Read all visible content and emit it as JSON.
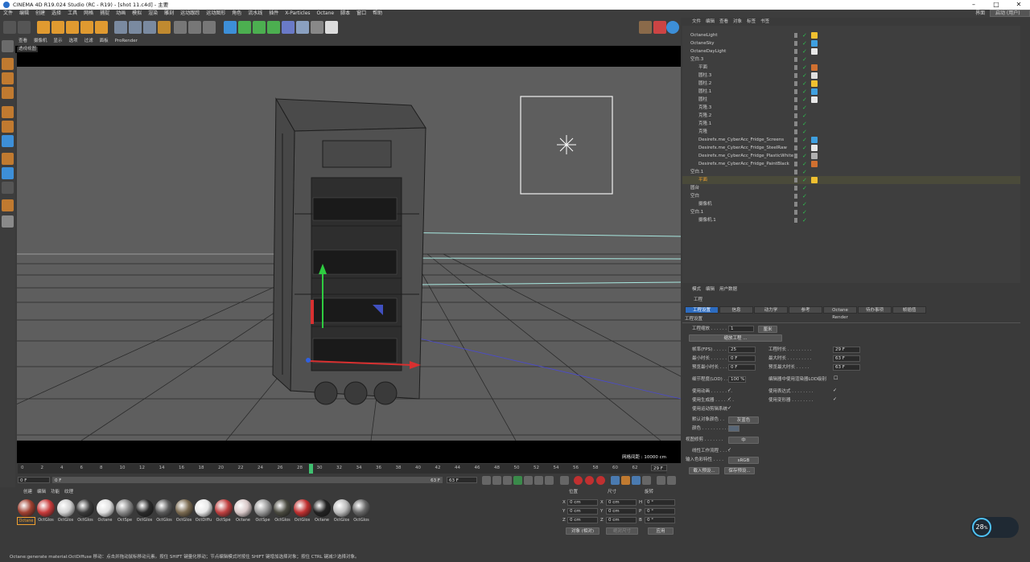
{
  "title": "CINEMA 4D R19.024 Studio (RC - R19) - [shot 11.c4d] - 主要",
  "layout": {
    "label": "界面",
    "value": "启动 (用户)"
  },
  "menu": [
    "文件",
    "编辑",
    "创建",
    "选择",
    "工具",
    "网格",
    "捕捉",
    "动画",
    "模拟",
    "渲染",
    "雕刻",
    "运动跟踪",
    "运动图形",
    "角色",
    "流水线",
    "插件",
    "X-Particles",
    "Octane",
    "脚本",
    "窗口",
    "帮助"
  ],
  "viewport": {
    "menu": [
      "查看",
      "摄像机",
      "显示",
      "选项",
      "过滤",
      "面板",
      "ProRender"
    ],
    "tab": "透视视图",
    "info": "网格间距 : 10000 cm"
  },
  "timeline": {
    "ticks": [
      "0",
      "2",
      "4",
      "6",
      "8",
      "10",
      "12",
      "14",
      "16",
      "18",
      "20",
      "22",
      "24",
      "26",
      "28",
      "30",
      "32",
      "34",
      "36",
      "38",
      "40",
      "42",
      "44",
      "46",
      "48",
      "50",
      "52",
      "54",
      "56",
      "58",
      "60",
      "62"
    ],
    "current": "29 F",
    "start": "0 F",
    "field2": "0 F",
    "end_a": "63 F",
    "end_b": "63 F"
  },
  "materials": {
    "tabs": [
      "创建",
      "编辑",
      "功能",
      "纹理"
    ],
    "items": [
      "Octane",
      "OctGlos",
      "OctGlos",
      "OctGlos",
      "Octane",
      "OctSpe",
      "OctGlos",
      "OctGlos",
      "OctGlos",
      "OctDiffu",
      "OctSpe",
      "Octane",
      "OctSpe",
      "OctGlos",
      "OctGlos",
      "Octane",
      "OctGlos",
      "OctGlos"
    ]
  },
  "coords": {
    "headers": [
      "位置",
      "尺寸",
      "旋转"
    ],
    "rows": [
      {
        "axis": "X",
        "pos": "0 cm",
        "size_axis": "X",
        "size": "0 cm",
        "rot_axis": "H",
        "rot": "0 °"
      },
      {
        "axis": "Y",
        "pos": "0 cm",
        "size_axis": "Y",
        "size": "0 cm",
        "rot_axis": "P",
        "rot": "0 °"
      },
      {
        "axis": "Z",
        "pos": "0 cm",
        "size_axis": "Z",
        "size": "0 cm",
        "rot_axis": "B",
        "rot": "0 °"
      }
    ],
    "mode": "对象 (相对)",
    "size_mode": "绝对尺寸",
    "apply": "应用"
  },
  "objects": {
    "menu": [
      "文件",
      "编辑",
      "查看",
      "对象",
      "标签",
      "书签"
    ],
    "rows": [
      {
        "name": "OctaneLight",
        "indent": 0
      },
      {
        "name": "OctaneSky",
        "indent": 0
      },
      {
        "name": "OctaneDayLight",
        "indent": 0
      },
      {
        "name": "空白.3",
        "indent": 0
      },
      {
        "name": "平面",
        "indent": 1
      },
      {
        "name": "圆柱.3",
        "indent": 1
      },
      {
        "name": "圆柱.2",
        "indent": 1
      },
      {
        "name": "圆柱.1",
        "indent": 1
      },
      {
        "name": "圆柱",
        "indent": 1
      },
      {
        "name": "克隆.3",
        "indent": 1
      },
      {
        "name": "克隆.2",
        "indent": 1
      },
      {
        "name": "克隆.1",
        "indent": 1
      },
      {
        "name": "克隆",
        "indent": 1
      },
      {
        "name": "Desirefx.me_CyberAcc_Fridge_Screens",
        "indent": 1
      },
      {
        "name": "Desirefx.me_CyberAcc_Fridge_SteelRaw",
        "indent": 1
      },
      {
        "name": "Desirefx.me_CyberAcc_Fridge_PlasticWhite",
        "indent": 1
      },
      {
        "name": "Desirefx.me_CyberAcc_Fridge_PaintBlack",
        "indent": 1
      },
      {
        "name": "空白.1",
        "indent": 0
      },
      {
        "name": "平面",
        "indent": 1
      },
      {
        "name": "圆台",
        "indent": 0
      },
      {
        "name": "空白",
        "indent": 0
      },
      {
        "name": "摄像机",
        "indent": 1
      },
      {
        "name": "空白.1",
        "indent": 0
      },
      {
        "name": "摄像机.1",
        "indent": 1
      }
    ]
  },
  "attributes": {
    "menu": [
      "模式",
      "编辑",
      "用户数据"
    ],
    "header": "工程",
    "tabs": [
      "工程设置",
      "信息",
      "动力学",
      "参考",
      "Octane Render",
      "待办事项",
      "帧插值"
    ],
    "section": "工程设置",
    "scale_label": "工程缩放 . . . . . . . .",
    "scale_value": "1",
    "scale_unit": "厘米",
    "scale_btn": "缩放工程 ...",
    "fps_label": "帧率(FPS) . . . . . . .",
    "fps": "25",
    "duration_label": "工程时长 . . . . . . . . .",
    "duration": "29 F",
    "min_label": "最小时长 . . . . . . . .",
    "min": "0 F",
    "max_label": "最大时长 . . . . . . . . .",
    "max": "63 F",
    "pmin_label": "预览最小时长 . . . .",
    "pmin": "0 F",
    "pmax_label": "预览最大时长 . . . . .",
    "pmax": "63 F",
    "lod_label": "细节程度(LOD) . . . .",
    "lod": "100 %",
    "lod2_label": "编辑器中使用渲染器LOD级别",
    "anim_label": "使用动画 . . . . . . . .",
    "expr_label": "使用表达式 . . . . . . . .",
    "gen_label": "使用生成器 . . . . . . .",
    "deform_label": "使用变形器 . . . . . . . .",
    "motion_label": "使用运动剪辑系统",
    "color_label": "默认对象颜色 . .",
    "color_value": "灰蓝色",
    "col_label": "颜色 . . . . . . . . . .",
    "clip_label": "视图修剪 . . . . . . .",
    "clip_value": "中",
    "linear_label": "线性工作流程 . . . .",
    "input_label": "输入色彩特性 . . . .",
    "input_value": "sRGB",
    "btn_load": "载入预设...",
    "btn_save": "保存预设..."
  },
  "status": "Octane:generate material:OctDiffuse    移动：点击并拖动鼠标移动元素。按住 SHIFT 键量化移动；节点编辑模式时按住 SHIFT 键增加选择对象；按住 CTRL 键减少选择对象。",
  "gauge": {
    "value": "28",
    "unit": "%"
  }
}
